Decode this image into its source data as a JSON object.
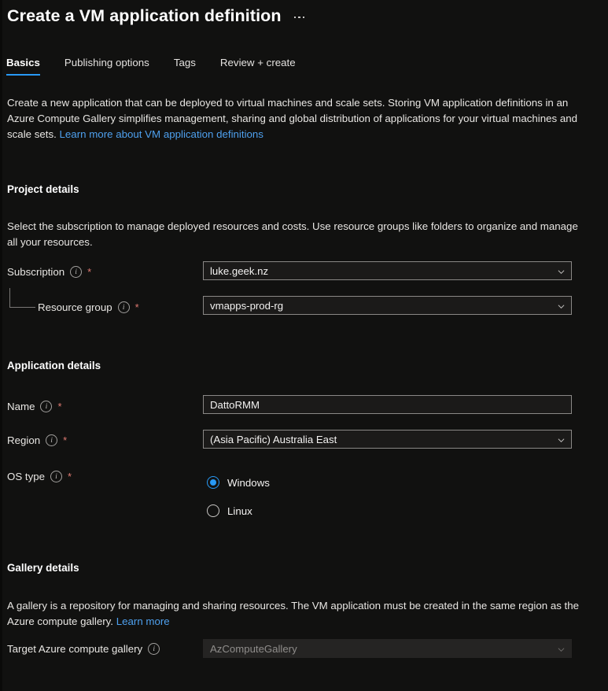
{
  "header": {
    "title": "Create a VM application definition",
    "more_menu": "…"
  },
  "tabs": [
    {
      "label": "Basics",
      "active": true
    },
    {
      "label": "Publishing options",
      "active": false
    },
    {
      "label": "Tags",
      "active": false
    },
    {
      "label": "Review + create",
      "active": false
    }
  ],
  "intro": {
    "text": "Create a new application that can be deployed to virtual machines and scale sets. Storing VM application definitions in an Azure Compute Gallery simplifies management, sharing and global distribution of applications for your virtual machines and scale sets. ",
    "link": "Learn more about VM application definitions"
  },
  "project_details": {
    "heading": "Project details",
    "description": "Select the subscription to manage deployed resources and costs. Use resource groups like folders to organize and manage all your resources.",
    "subscription": {
      "label": "Subscription",
      "required": "*",
      "value": "luke.geek.nz"
    },
    "resource_group": {
      "label": "Resource group",
      "required": "*",
      "value": "vmapps-prod-rg"
    }
  },
  "application_details": {
    "heading": "Application details",
    "name": {
      "label": "Name",
      "required": "*",
      "value": "DattoRMM",
      "placeholder": ""
    },
    "region": {
      "label": "Region",
      "required": "*",
      "value": "(Asia Pacific) Australia East"
    },
    "os_type": {
      "label": "OS type",
      "required": "*",
      "options": [
        {
          "label": "Windows",
          "selected": true
        },
        {
          "label": "Linux",
          "selected": false
        }
      ]
    }
  },
  "gallery_details": {
    "heading": "Gallery details",
    "description": "A gallery is a repository for managing and sharing resources. The VM application must be created in the same region as the Azure compute gallery. ",
    "link": "Learn more",
    "target_gallery": {
      "label": "Target Azure compute gallery",
      "placeholder": "AzComputeGallery",
      "value": ""
    }
  },
  "icons": {
    "info": "i",
    "chevron_down": "chevron-down"
  },
  "colors": {
    "background": "#111110",
    "accent": "#2899f5",
    "link": "#4ea0ee",
    "required_asterisk": "#e07a72",
    "field_background": "#1b1a19",
    "field_border": "#8a8886",
    "field_disabled_background": "#252423"
  }
}
